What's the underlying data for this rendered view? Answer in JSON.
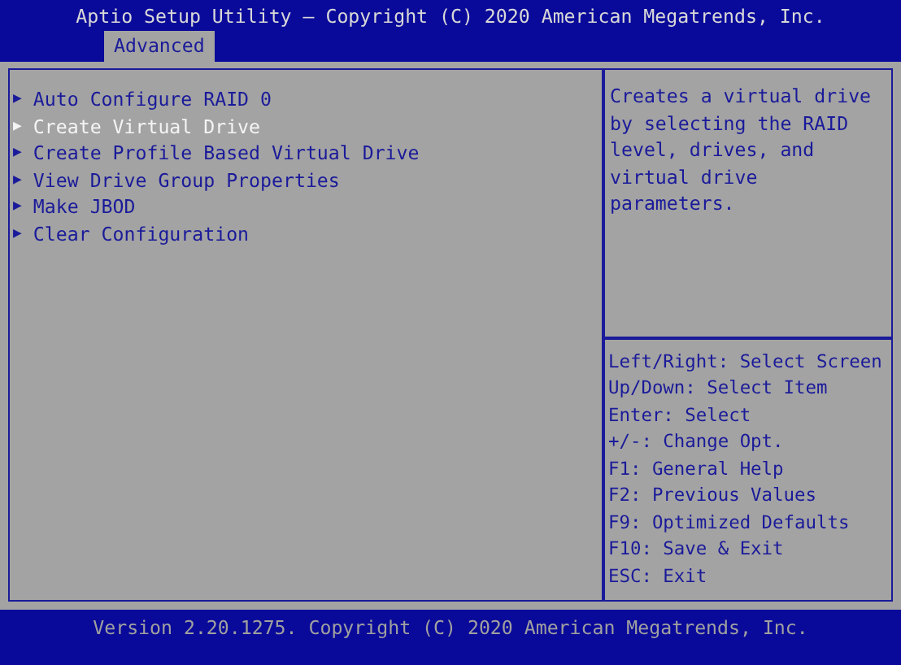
{
  "header": {
    "title": "Aptio Setup Utility – Copyright (C) 2020 American Megatrends, Inc."
  },
  "tabs": [
    {
      "label": "Advanced",
      "selected": true
    }
  ],
  "menu": {
    "items": [
      {
        "arrow": "▶",
        "label": "Auto Configure RAID 0",
        "selected": false
      },
      {
        "arrow": "▶",
        "label": "Create Virtual Drive",
        "selected": true
      },
      {
        "arrow": "▶",
        "label": "Create Profile Based Virtual Drive",
        "selected": false
      },
      {
        "arrow": "▶",
        "label": "View Drive Group Properties",
        "selected": false
      },
      {
        "arrow": "▶",
        "label": "Make JBOD",
        "selected": false
      },
      {
        "arrow": "▶",
        "label": "Clear Configuration",
        "selected": false
      }
    ]
  },
  "help": {
    "text": "Creates a virtual drive by selecting the RAID level, drives, and virtual drive parameters.",
    "keys": [
      "Left/Right: Select Screen",
      "Up/Down: Select Item",
      "Enter: Select",
      "+/-: Change Opt.",
      "F1: General Help",
      "F2: Previous Values",
      "F9: Optimized Defaults",
      "F10: Save & Exit",
      "ESC: Exit"
    ]
  },
  "footer": {
    "version": "Version 2.20.1275. Copyright (C) 2020 American Megatrends, Inc."
  }
}
